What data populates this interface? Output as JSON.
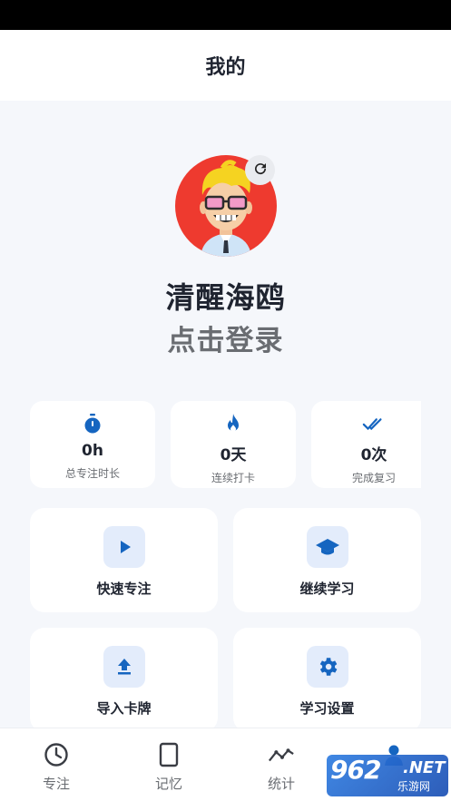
{
  "header": {
    "title": "我的"
  },
  "profile": {
    "nickname": "清醒海鸥",
    "login_prompt": "点击登录"
  },
  "stats": [
    {
      "icon": "stopwatch-icon",
      "value": "0h",
      "label": "总专注时长"
    },
    {
      "icon": "flame-icon",
      "value": "0天",
      "label": "连续打卡"
    },
    {
      "icon": "double-check-icon",
      "value": "0次",
      "label": "完成复习"
    }
  ],
  "actions": [
    {
      "icon": "play-icon",
      "label": "快速专注"
    },
    {
      "icon": "graduation-cap-icon",
      "label": "继续学习"
    },
    {
      "icon": "upload-icon",
      "label": "导入卡牌"
    },
    {
      "icon": "gear-icon",
      "label": "学习设置"
    }
  ],
  "tabs": [
    {
      "icon": "clock-icon",
      "label": "专注"
    },
    {
      "icon": "card-icon",
      "label": "记忆"
    },
    {
      "icon": "trend-icon",
      "label": "统计"
    },
    {
      "icon": "profile-icon",
      "label": ""
    }
  ],
  "watermark": {
    "main": "962",
    "suffix": ".NET",
    "sub": "乐游网"
  },
  "colors": {
    "accent": "#1565c0",
    "avatar_bg": "#ee3a2f",
    "page_bg": "#f5f7fb"
  }
}
